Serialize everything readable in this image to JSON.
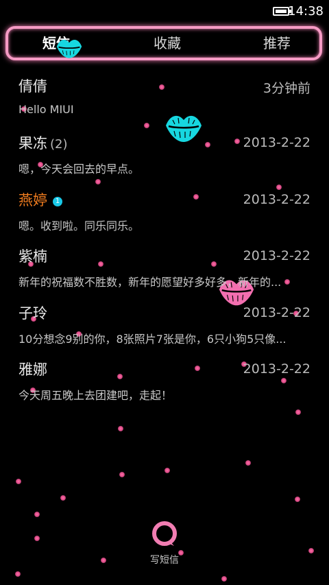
{
  "status_bar": {
    "time": "14:38",
    "battery_icon": "battery-icon"
  },
  "tabs": [
    {
      "label": "短信",
      "active": true
    },
    {
      "label": "收藏",
      "active": false
    },
    {
      "label": "推荐",
      "active": false
    }
  ],
  "conversations": [
    {
      "name": "倩倩",
      "count": "",
      "badge": "",
      "time": "3分钟前",
      "preview": "Hello MIUI",
      "unread": false
    },
    {
      "name": "果冻",
      "count": "(2)",
      "badge": "",
      "time": "2013-2-22",
      "preview": "嗯，今天会回去的早点。",
      "unread": false
    },
    {
      "name": "燕婷",
      "count": "",
      "badge": "1",
      "time": "2013-2-22",
      "preview": "嗯。收到啦。同乐同乐。",
      "unread": true
    },
    {
      "name": "紫楠",
      "count": "",
      "badge": "",
      "time": "2013-2-22",
      "preview": "新年的祝福数不胜数，新年的愿望好多好多，新年的...",
      "unread": false
    },
    {
      "name": "子玲",
      "count": "",
      "badge": "",
      "time": "2013-2-22",
      "preview": "10分想念9别的你，8张照片7张是你，6只小狗5只像...",
      "unread": false
    },
    {
      "name": "雅娜",
      "count": "",
      "badge": "",
      "time": "2013-2-22",
      "preview": "今天周五晚上去团建吧，走起！",
      "unread": false
    }
  ],
  "compose": {
    "label": "写短信",
    "icon": "compose-message-icon"
  },
  "colors": {
    "accent_pink": "#f59ac4",
    "unread_orange": "#f07c1f",
    "badge_cyan": "#19c9e8",
    "kiss_cyan": "#17d7e0",
    "kiss_pink": "#f36fb0"
  }
}
